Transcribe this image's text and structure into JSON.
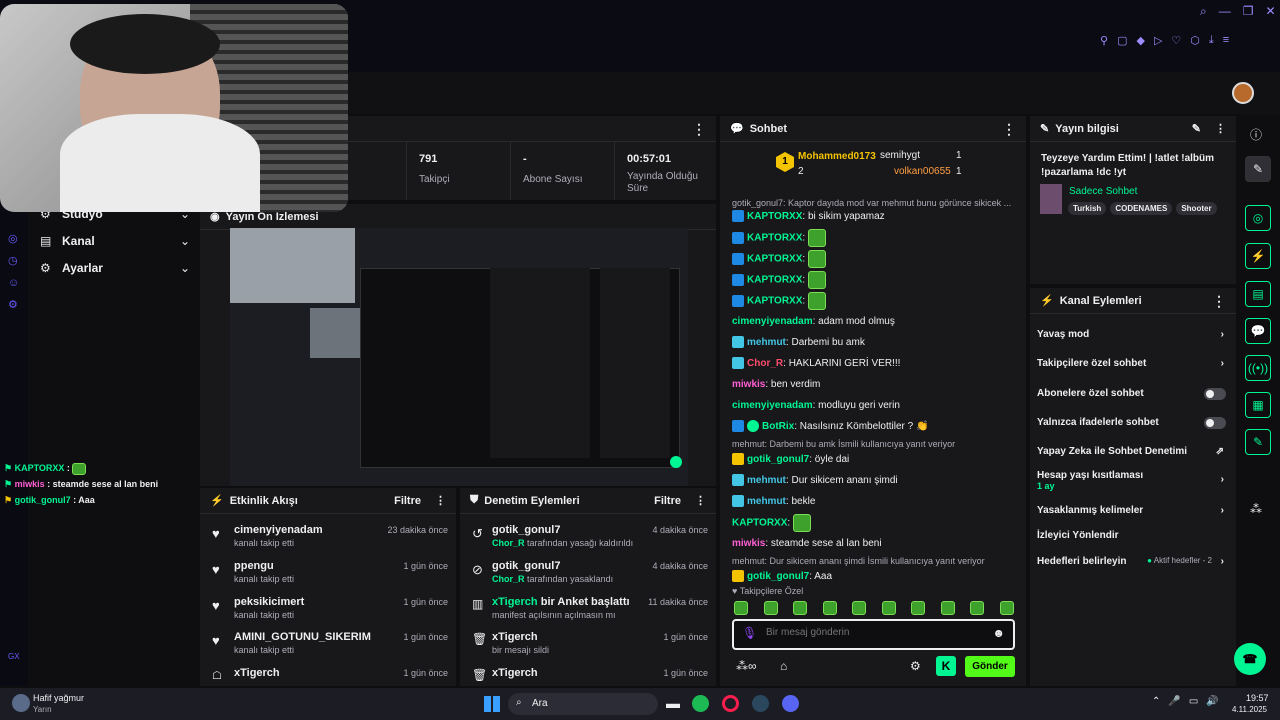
{
  "colors": {
    "accent": "#00f593",
    "bg": "#0e0e10",
    "panel": "#18181b",
    "purple": "#9147ff"
  },
  "stats": [
    {
      "value": "791",
      "label": "Takipçi"
    },
    {
      "value": "-",
      "label": "Abone Sayısı"
    },
    {
      "value": "00:57:01",
      "label": "Yayında Olduğu Süre"
    }
  ],
  "nav": [
    {
      "icon": "gear-icon",
      "label": "Stüdyo"
    },
    {
      "icon": "bank-icon",
      "label": "Kanal"
    },
    {
      "icon": "gear-icon",
      "label": "Ayarlar"
    }
  ],
  "preview_title": "Yayın Ön İzlemesi",
  "overlay_chat": [
    {
      "user": "KAPTORXX",
      "text": ""
    },
    {
      "user": "miwkis",
      "text": "steamde sese al lan beni"
    },
    {
      "user": "gotik_gonul7",
      "text": "Aaa"
    }
  ],
  "activity": {
    "title": "Etkinlik Akışı",
    "filter": "Filtre",
    "items": [
      {
        "user": "cimenyiyenadam",
        "desc": "kanalı takip etti",
        "time": "23 dakika önce"
      },
      {
        "user": "ppengu",
        "desc": "kanalı takip etti",
        "time": "1 gün önce"
      },
      {
        "user": "peksikicimert",
        "desc": "kanalı takip etti",
        "time": "1 gün önce"
      },
      {
        "user": "AMINI_GOTUNU_SIKERIM",
        "desc": "kanalı takip etti",
        "time": "1 gün önce"
      },
      {
        "user": "xTigerch",
        "desc": "",
        "time": "1 gün önce"
      }
    ]
  },
  "mod": {
    "title": "Denetim Eylemleri",
    "filter": "Filtre",
    "items": [
      {
        "user": "gotik_gonul7",
        "actor": "Chor_R",
        "desc": "tarafından yasağı kaldırıldı",
        "time": "4 dakika önce"
      },
      {
        "user": "gotik_gonul7",
        "actor": "Chor_R",
        "desc": "tarafından yasaklandı",
        "time": "4 dakika önce"
      },
      {
        "user": "xTigerch",
        "actor": "",
        "desc": "bir Anket başlattı",
        "sub": "manifest açılsının açılmasın mı",
        "time": "11 dakika önce"
      },
      {
        "user": "xTigerch",
        "actor": "",
        "desc": "",
        "sub": "bir mesajı sildi",
        "time": "1 gün önce"
      },
      {
        "user": "xTigerch",
        "actor": "",
        "desc": "",
        "sub": "",
        "time": "1 gün önce"
      }
    ]
  },
  "chat": {
    "title": "Sohbet",
    "top": [
      {
        "name": "Mohammed0173",
        "count": "2"
      },
      {
        "name": "semihygt",
        "count": "1"
      },
      {
        "name": "volkan00655",
        "count": "1"
      }
    ],
    "reply1": "gotik_gonul7: Kaptor dayıda mod var mehmut bunu görünce sikicek ...",
    "messages": [
      {
        "user": "KAPTORXX",
        "color": "#00f593",
        "text": "bi sikim yapamaz",
        "emote": false
      },
      {
        "user": "KAPTORXX",
        "color": "#00f593",
        "text": "",
        "emote": true
      },
      {
        "user": "KAPTORXX",
        "color": "#00f593",
        "text": "",
        "emote": true
      },
      {
        "user": "KAPTORXX",
        "color": "#00f593",
        "text": "",
        "emote": true
      },
      {
        "user": "KAPTORXX",
        "color": "#00f593",
        "text": "",
        "emote": true
      },
      {
        "user": "cimenyiyenadam",
        "color": "#00f593",
        "text": "adam mod olmuş",
        "emote": false
      },
      {
        "user": "mehmut",
        "color": "#43c6e6",
        "text": "Darbemi bu amk",
        "emote": false
      },
      {
        "user": "Chor_R",
        "color": "#ff4d6d",
        "text": "HAKLARINI GERİ VER!!!",
        "emote": false
      },
      {
        "user": "miwkis",
        "color": "#ff5fd2",
        "text": "ben verdim",
        "emote": false
      },
      {
        "user": "cimenyiyenadam",
        "color": "#00f593",
        "text": "modluyu geri verin",
        "emote": false
      },
      {
        "user": "BotRix",
        "color": "#00f593",
        "text": "Nasılsınız Kömbelottiler ? 👏",
        "emote": false
      },
      {
        "reply": "mehmut: Darbemi bu amk İsmili kullanıcıya yanıt veriyor"
      },
      {
        "user": "gotik_gonul7",
        "color": "#00f593",
        "text": "öyle dai",
        "emote": false
      },
      {
        "user": "mehmut",
        "color": "#43c6e6",
        "text": "Dur sikicem ananı şimdi",
        "emote": false
      },
      {
        "user": "mehmut",
        "color": "#43c6e6",
        "text": "bekle",
        "emote": false
      },
      {
        "user": "KAPTORXX",
        "color": "#00f593",
        "text": "",
        "emote": true
      },
      {
        "user": "miwkis",
        "color": "#ff5fd2",
        "text": "steamde sese al lan beni",
        "emote": false
      },
      {
        "reply": "mehmut: Dur sikicem ananı şimdi İsmili kullanıcıya yanıt veriyor"
      },
      {
        "user": "gotik_gonul7",
        "color": "#00f593",
        "text": "Aaa",
        "emote": false
      }
    ],
    "followers_only": "Takipçilere Özel",
    "placeholder": "Bir mesaj gönderin",
    "send": "Gönder"
  },
  "stream_info": {
    "title": "Yayın bilgisi",
    "stream_title": "Teyzeye Yardım Ettim! | !atlet !albüm !pazarlama !dc !yt",
    "category": "Sadece Sohbet",
    "tags": [
      "Turkish",
      "CODENAMES",
      "Shooter"
    ]
  },
  "actions": {
    "title": "Kanal Eylemleri",
    "items": [
      {
        "label": "Yavaş mod",
        "type": "arrow"
      },
      {
        "label": "Takipçilere özel sohbet",
        "type": "arrow"
      },
      {
        "label": "Abonelere özel sohbet",
        "type": "toggle"
      },
      {
        "label": "Yalnızca ifadelerle sohbet",
        "type": "toggle"
      },
      {
        "label": "Yapay Zeka ile Sohbet Denetimi",
        "type": "ext"
      },
      {
        "label": "Hesap yaşı kısıtlaması",
        "sub": "1 ay",
        "type": "arrow"
      },
      {
        "label": "Yasaklanmış kelimeler",
        "type": "arrow"
      },
      {
        "label": "İzleyici Yönlendir",
        "type": "none"
      },
      {
        "label": "Hedefleri belirleyin",
        "extra": "Aktif hedefler - 2",
        "type": "arrow"
      }
    ]
  },
  "taskbar": {
    "weather": "Hafif yağmur",
    "weather_sub": "Yarın",
    "search": "Ara",
    "time": "19:57",
    "date": "4.11.2025"
  },
  "gx": "GX"
}
